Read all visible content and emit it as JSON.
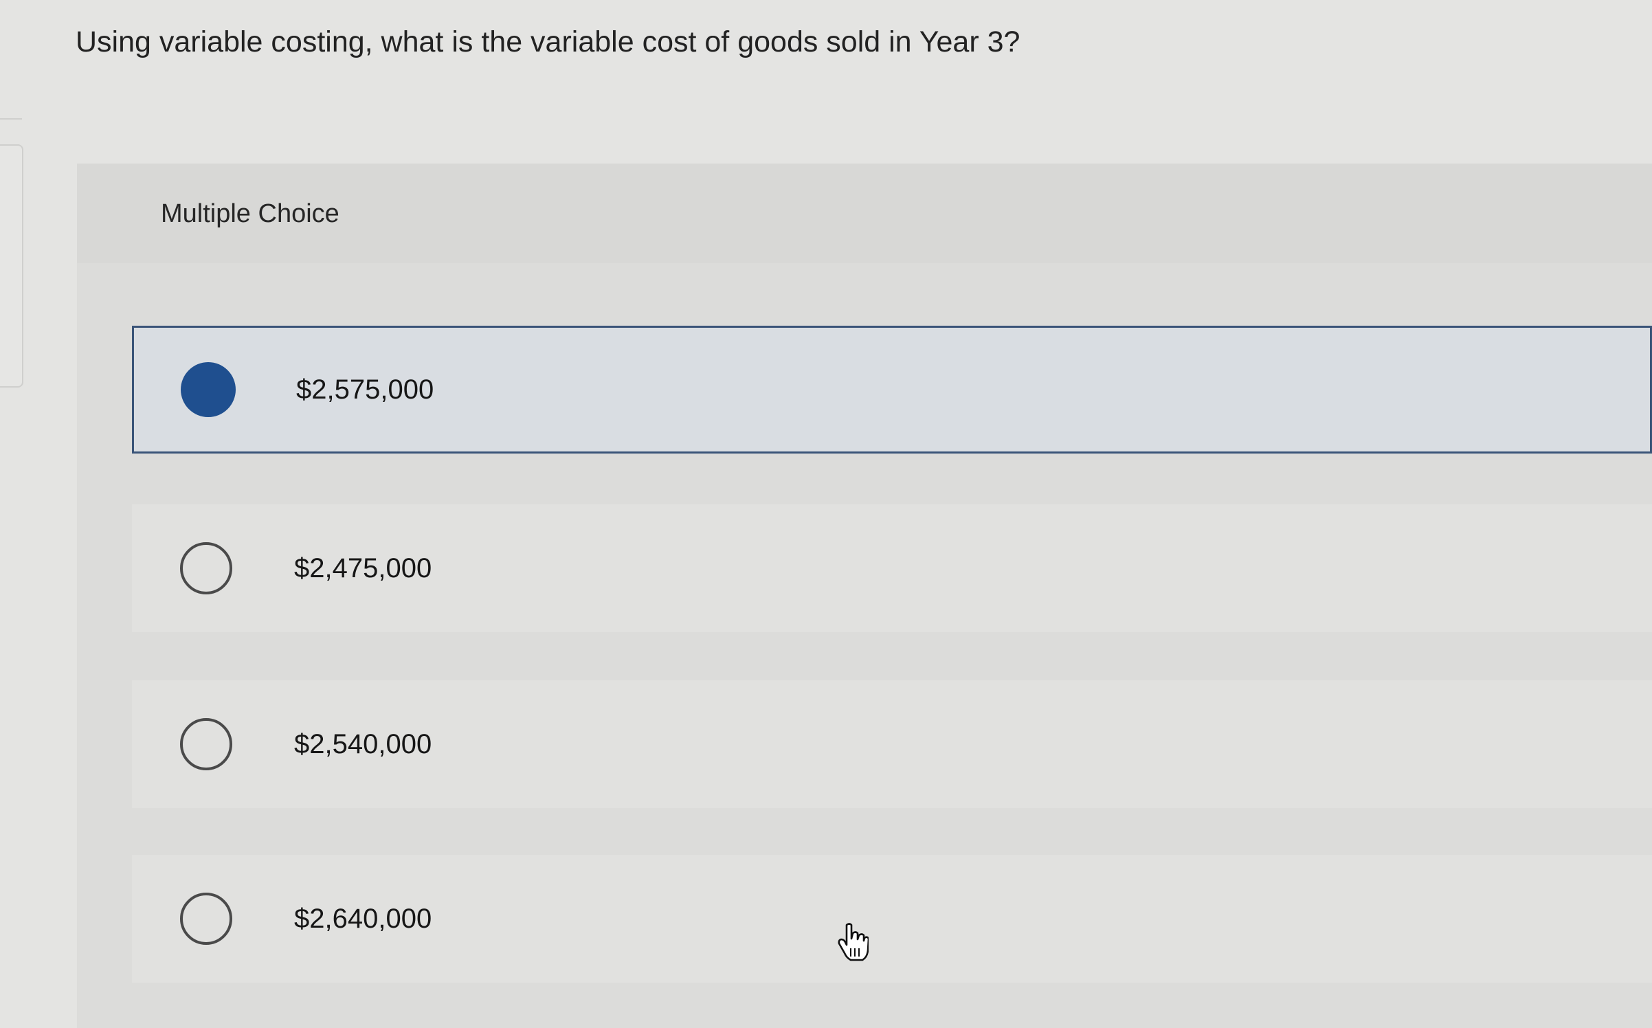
{
  "question": {
    "text": "Using variable costing, what is the variable cost of goods sold in Year 3?"
  },
  "multiple_choice": {
    "title": "Multiple Choice",
    "selected_index": 0,
    "options": [
      {
        "label": "$2,575,000",
        "selected": true
      },
      {
        "label": "$2,475,000",
        "selected": false
      },
      {
        "label": "$2,540,000",
        "selected": false
      },
      {
        "label": "$2,640,000",
        "selected": false
      }
    ]
  },
  "colors": {
    "selected_radio": "#1f4f8f",
    "selected_border": "#3a5478"
  },
  "icons": {
    "cursor": "hand-pointer-cursor-icon",
    "radio_selected": "radio-selected-icon",
    "radio_unselected": "radio-unselected-icon"
  }
}
